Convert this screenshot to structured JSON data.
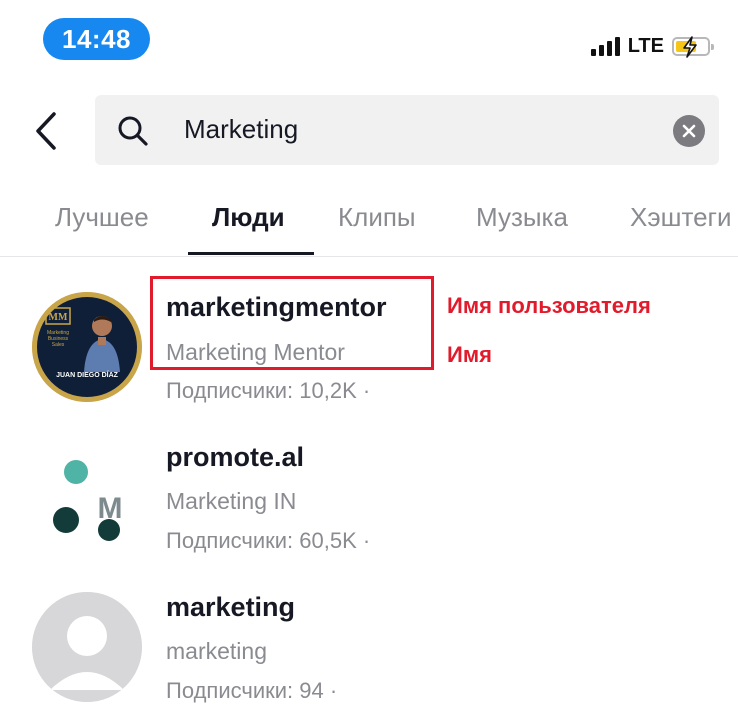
{
  "status_bar": {
    "time": "14:48",
    "network": "LTE"
  },
  "search": {
    "query": "Marketing"
  },
  "tabs": [
    {
      "label": "Лучшее"
    },
    {
      "label": "Люди"
    },
    {
      "label": "Клипы"
    },
    {
      "label": "Музыка"
    },
    {
      "label": "Хэштеги"
    }
  ],
  "active_tab": "Люди",
  "results": [
    {
      "username": "marketingmentor",
      "display_name": "Marketing Mentor",
      "followers": "Подписчики: 10,2K ·",
      "avatar": {
        "monogram": "MM",
        "line1": "Marketing",
        "line2": "Business",
        "line3": "Sales",
        "caption": "JUAN DIEGO DÍAZ"
      }
    },
    {
      "username": "promote.al",
      "display_name": "Marketing IN",
      "followers": "Подписчики: 60,5K ·",
      "avatar": {
        "letter": "M"
      }
    },
    {
      "username": "marketing",
      "display_name": "marketing",
      "followers": "Подписчики: 94 ·"
    }
  ],
  "annotations": {
    "username_label": "Имя пользователя",
    "name_label": "Имя"
  },
  "colors": {
    "accent_blue": "#1688f0",
    "annotation_red": "#e21b2c",
    "gold_ring": "#c9a54a",
    "teal": "#1f5a55"
  }
}
